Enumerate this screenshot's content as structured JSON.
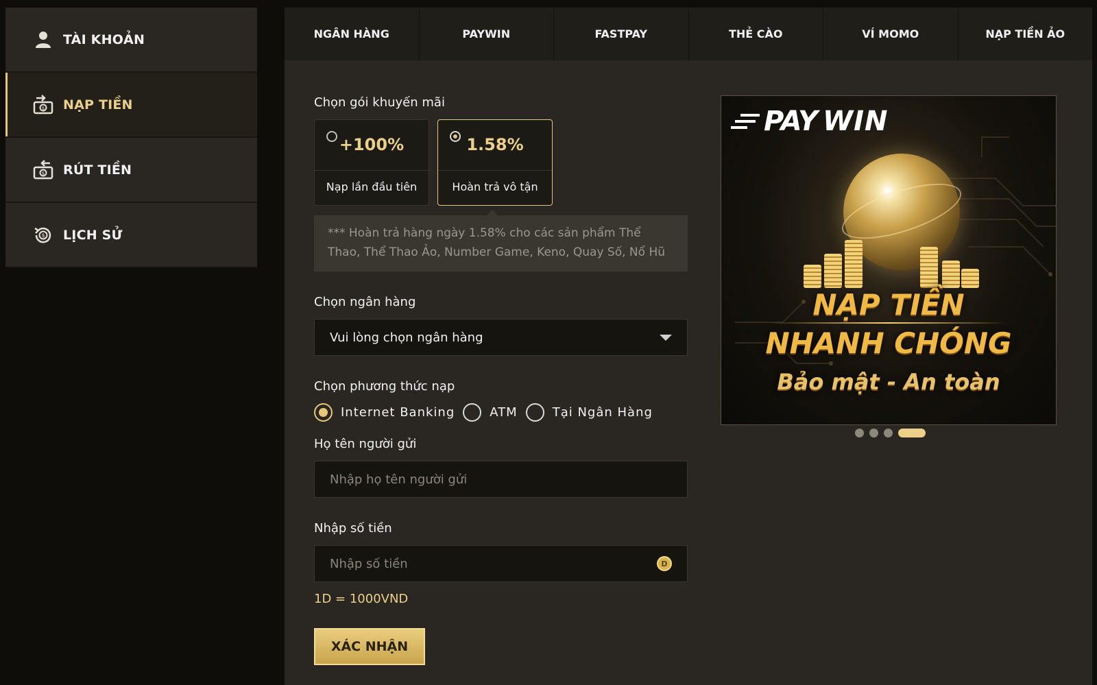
{
  "sidebar": {
    "items": [
      {
        "label": "TÀI KHOẢN",
        "icon": "user-icon"
      },
      {
        "label": "NẠP TIỀN",
        "icon": "deposit-icon",
        "active": true
      },
      {
        "label": "RÚT TIỀN",
        "icon": "withdraw-icon"
      },
      {
        "label": "LỊCH SỬ",
        "icon": "history-icon"
      }
    ]
  },
  "tabs": [
    "NGÂN HÀNG",
    "PAYWIN",
    "FASTPAY",
    "THẺ CÀO",
    "VÍ MOMO",
    "NẠP TIỀN ẢO"
  ],
  "form": {
    "promo_label": "Chọn gói khuyến mãi",
    "promos": [
      {
        "value": "+100%",
        "desc": "Nạp lần đầu tiên",
        "selected": false
      },
      {
        "value": "1.58%",
        "desc": "Hoàn trả vô tận",
        "selected": true
      }
    ],
    "promo_note": "*** Hoàn trả hàng ngày 1.58% cho các sản phẩm Thể Thao, Thể Thao Ảo, Number Game, Keno, Quay Số, Nổ Hũ",
    "bank_label": "Chọn ngân hàng",
    "bank_select": "Vui lòng chọn ngân hàng",
    "method_label": "Chọn phương thức nạp",
    "methods": [
      {
        "label": "Internet Banking",
        "checked": true
      },
      {
        "label": "ATM",
        "checked": false
      },
      {
        "label": "Tại Ngân Hàng",
        "checked": false
      }
    ],
    "sender_label": "Họ tên người gửi",
    "sender_placeholder": "Nhập họ tên người gửi",
    "amount_label": "Nhập số tiền",
    "amount_placeholder": "Nhập số tiền",
    "coin_symbol": "D",
    "rate": "1D = 1000VND",
    "confirm": "XÁC NHẬN"
  },
  "banner": {
    "brand_pay": "PAY",
    "brand_win": "WIN",
    "title_line1": "NẠP TIỀN",
    "title_line2": "NHANH CHÓNG",
    "title_line3": "Bảo mật - An toàn",
    "dots": 4,
    "active_dot": 3
  },
  "colors": {
    "accent": "#ecd08a",
    "panel": "#2a2722",
    "background": "#0f0d0a"
  }
}
